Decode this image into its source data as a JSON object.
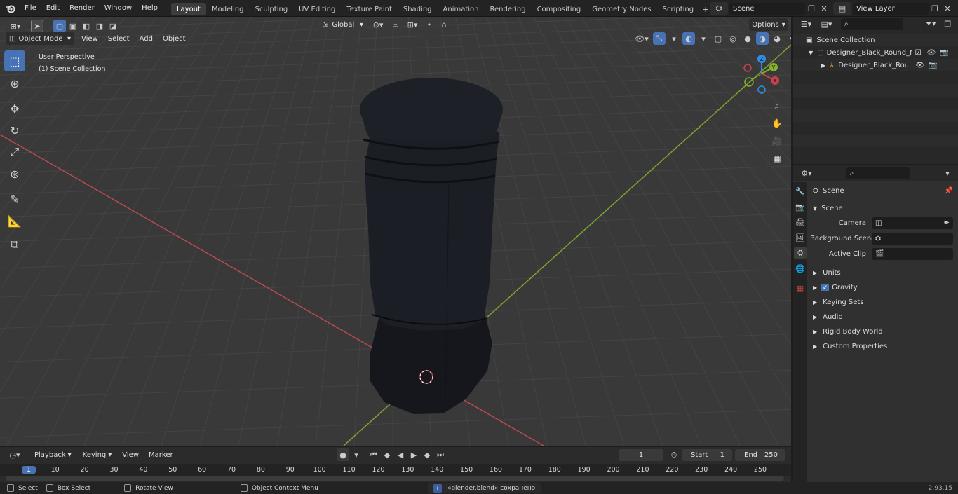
{
  "menu": {
    "file": "File",
    "edit": "Edit",
    "render": "Render",
    "window": "Window",
    "help": "Help"
  },
  "workspaces": [
    "Layout",
    "Modeling",
    "Sculpting",
    "UV Editing",
    "Texture Paint",
    "Shading",
    "Animation",
    "Rendering",
    "Compositing",
    "Geometry Nodes",
    "Scripting"
  ],
  "active_workspace": "Layout",
  "scene_field": "Scene",
  "view_layer_field": "View Layer",
  "viewport": {
    "mode": "Object Mode",
    "menu_view": "View",
    "menu_select": "Select",
    "menu_add": "Add",
    "menu_object": "Object",
    "orientation": "Global",
    "options": "Options",
    "overlay_line1": "User Perspective",
    "overlay_line2": "(1) Scene Collection",
    "gizmo": {
      "z": "Z",
      "y": "Y",
      "x": "X"
    }
  },
  "outliner": {
    "root": "Scene Collection",
    "item1": "Designer_Black_Round_Metal",
    "item2": "Designer_Black_Round_M"
  },
  "properties": {
    "header": "Scene",
    "panel": "Scene",
    "camera_label": "Camera",
    "bg_scene_label": "Background Scene",
    "active_clip_label": "Active Clip",
    "sections": [
      "Units",
      "Gravity",
      "Keying Sets",
      "Audio",
      "Rigid Body World",
      "Custom Properties"
    ]
  },
  "timeline": {
    "playback": "Playback",
    "keying": "Keying",
    "view": "View",
    "marker": "Marker",
    "current_frame": "1",
    "start_label": "Start",
    "start": "1",
    "end_label": "End",
    "end": "250",
    "ruler": [
      "1",
      "10",
      "20",
      "30",
      "40",
      "50",
      "60",
      "70",
      "80",
      "90",
      "100",
      "110",
      "120",
      "130",
      "140",
      "150",
      "160",
      "170",
      "180",
      "190",
      "200",
      "210",
      "220",
      "230",
      "240",
      "250"
    ]
  },
  "status": {
    "select": "Select",
    "box_select": "Box Select",
    "rotate_view": "Rotate View",
    "context_menu": "Object Context Menu",
    "message": "«blender.blend» сохранено",
    "version": "2.93.15"
  },
  "colors": {
    "accent": "#4772b3",
    "x_axis": "#c8414f",
    "y_axis": "#87b12b",
    "z_axis": "#2f8de5"
  }
}
